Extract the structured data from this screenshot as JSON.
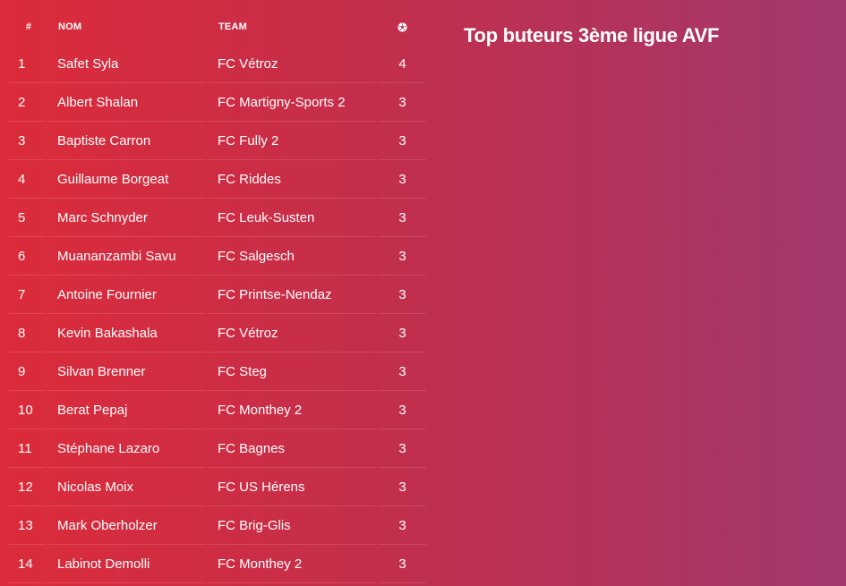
{
  "title": "Top buteurs 3ème ligue AVF",
  "table": {
    "headers": {
      "rank": "#",
      "name": "NOM",
      "team": "TEAM",
      "goals_icon": "soccer-ball-icon"
    },
    "rows": [
      {
        "rank": "1",
        "name": "Safet Syla",
        "team": "FC Vétroz",
        "goals": "4"
      },
      {
        "rank": "2",
        "name": "Albert Shalan",
        "team": "FC Martigny-Sports 2",
        "goals": "3"
      },
      {
        "rank": "3",
        "name": "Baptiste Carron",
        "team": "FC Fully 2",
        "goals": "3"
      },
      {
        "rank": "4",
        "name": "Guillaume Borgeat",
        "team": "FC Riddes",
        "goals": "3"
      },
      {
        "rank": "5",
        "name": "Marc Schnyder",
        "team": "FC Leuk-Susten",
        "goals": "3"
      },
      {
        "rank": "6",
        "name": "Muananzambi Savu",
        "team": "FC Salgesch",
        "goals": "3"
      },
      {
        "rank": "7",
        "name": "Antoine Fournier",
        "team": "FC Printse-Nendaz",
        "goals": "3"
      },
      {
        "rank": "8",
        "name": "Kevin Bakashala",
        "team": "FC Vétroz",
        "goals": "3"
      },
      {
        "rank": "9",
        "name": "Silvan Brenner",
        "team": "FC Steg",
        "goals": "3"
      },
      {
        "rank": "10",
        "name": "Berat Pepaj",
        "team": "FC Monthey 2",
        "goals": "3"
      },
      {
        "rank": "11",
        "name": "Stéphane Lazaro",
        "team": "FC Bagnes",
        "goals": "3"
      },
      {
        "rank": "12",
        "name": "Nicolas Moix",
        "team": "FC US Hérens",
        "goals": "3"
      },
      {
        "rank": "13",
        "name": "Mark Oberholzer",
        "team": "FC Brig-Glis",
        "goals": "3"
      },
      {
        "rank": "14",
        "name": "Labinot Demolli",
        "team": "FC Monthey 2",
        "goals": "3"
      }
    ]
  }
}
